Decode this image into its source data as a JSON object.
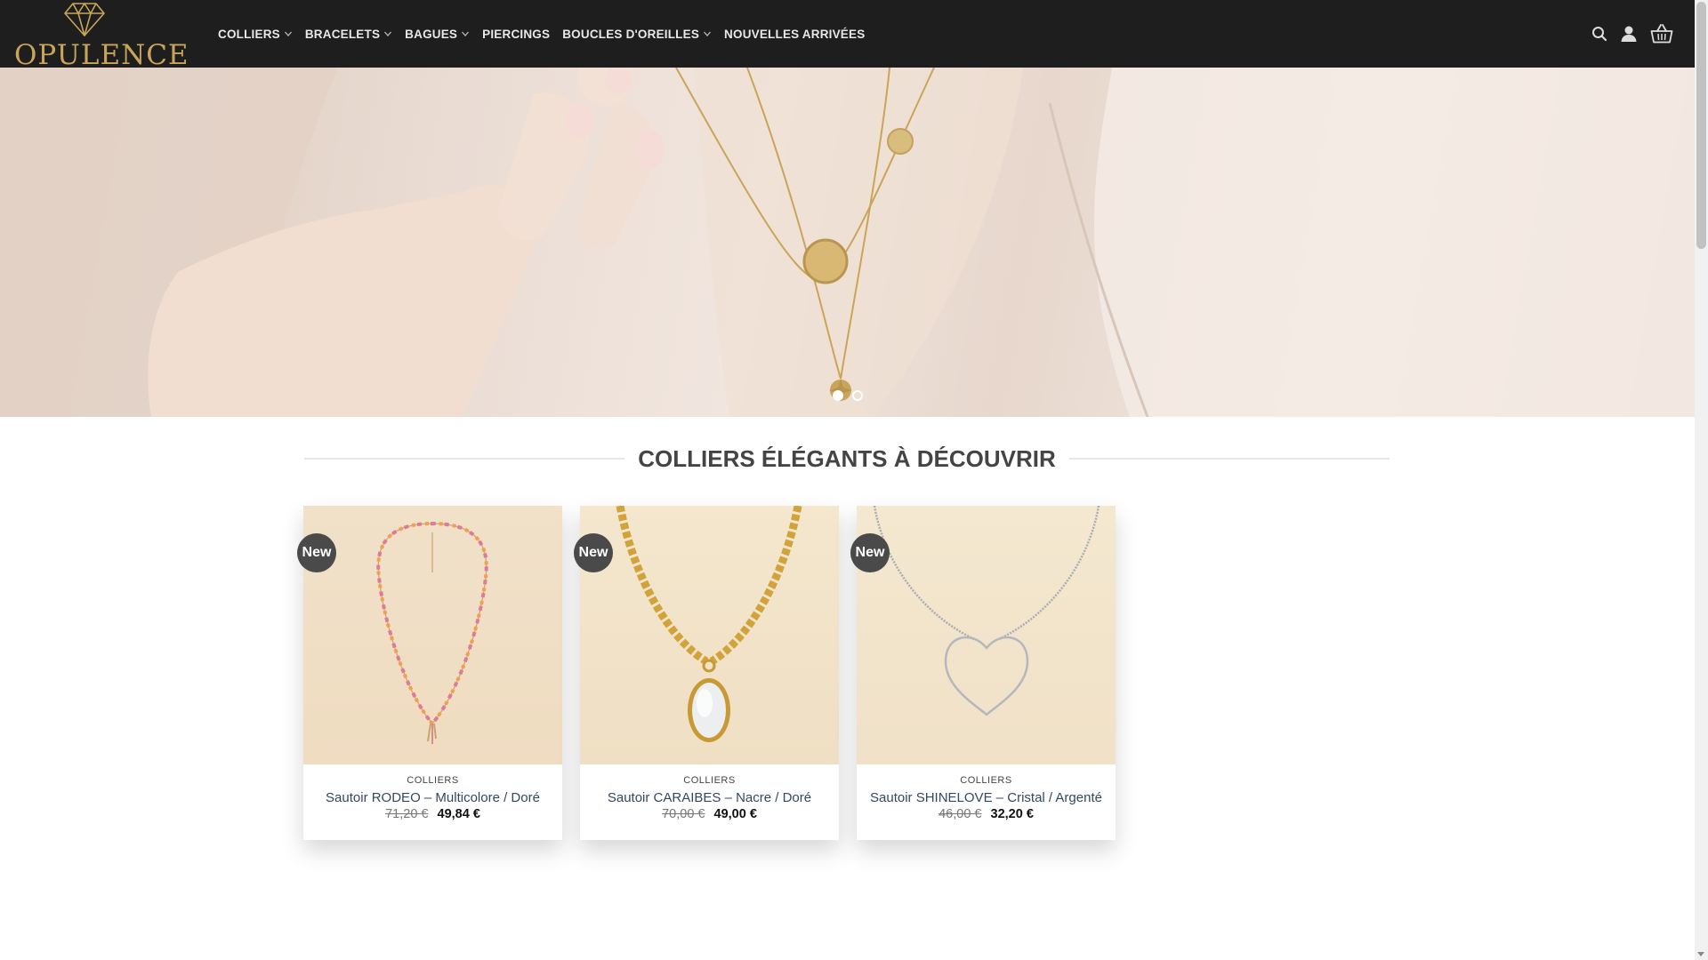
{
  "brand": {
    "name": "OPULENCE",
    "logo_icon": "diamond-icon",
    "gold": "#c9a55a"
  },
  "nav": [
    {
      "label": "COLLIERS",
      "dropdown": true
    },
    {
      "label": "BRACELETS",
      "dropdown": true
    },
    {
      "label": "BAGUES",
      "dropdown": true
    },
    {
      "label": "PIERCINGS",
      "dropdown": false
    },
    {
      "label": "BOUCLES D'OREILLES",
      "dropdown": true
    },
    {
      "label": "NOUVELLES ARRIVÉES",
      "dropdown": false
    }
  ],
  "header_icons": [
    "search-icon",
    "account-icon",
    "basket-icon"
  ],
  "hero": {
    "slides_count": 2,
    "active_slide": 1
  },
  "section": {
    "title": "COLLIERS ÉLÉGANTS À DÉCOUVRIR"
  },
  "products": [
    {
      "badge": "New",
      "category": "COLLIERS",
      "name": "Sautoir RODEO – Multicolore / Doré",
      "old_price": "71,20 €",
      "price": "49,84 €"
    },
    {
      "badge": "New",
      "category": "COLLIERS",
      "name": "Sautoir CARAIBES – Nacre / Doré",
      "old_price": "70,00 €",
      "price": "49,00 €"
    },
    {
      "badge": "New",
      "category": "COLLIERS",
      "name": "Sautoir SHINELOVE – Cristal / Argenté",
      "old_price": "46,00 €",
      "price": "32,20 €"
    }
  ],
  "colors": {
    "header_bg": "#1e1e1e",
    "badge_bg": "#4a4a4a",
    "link": "#334862"
  }
}
